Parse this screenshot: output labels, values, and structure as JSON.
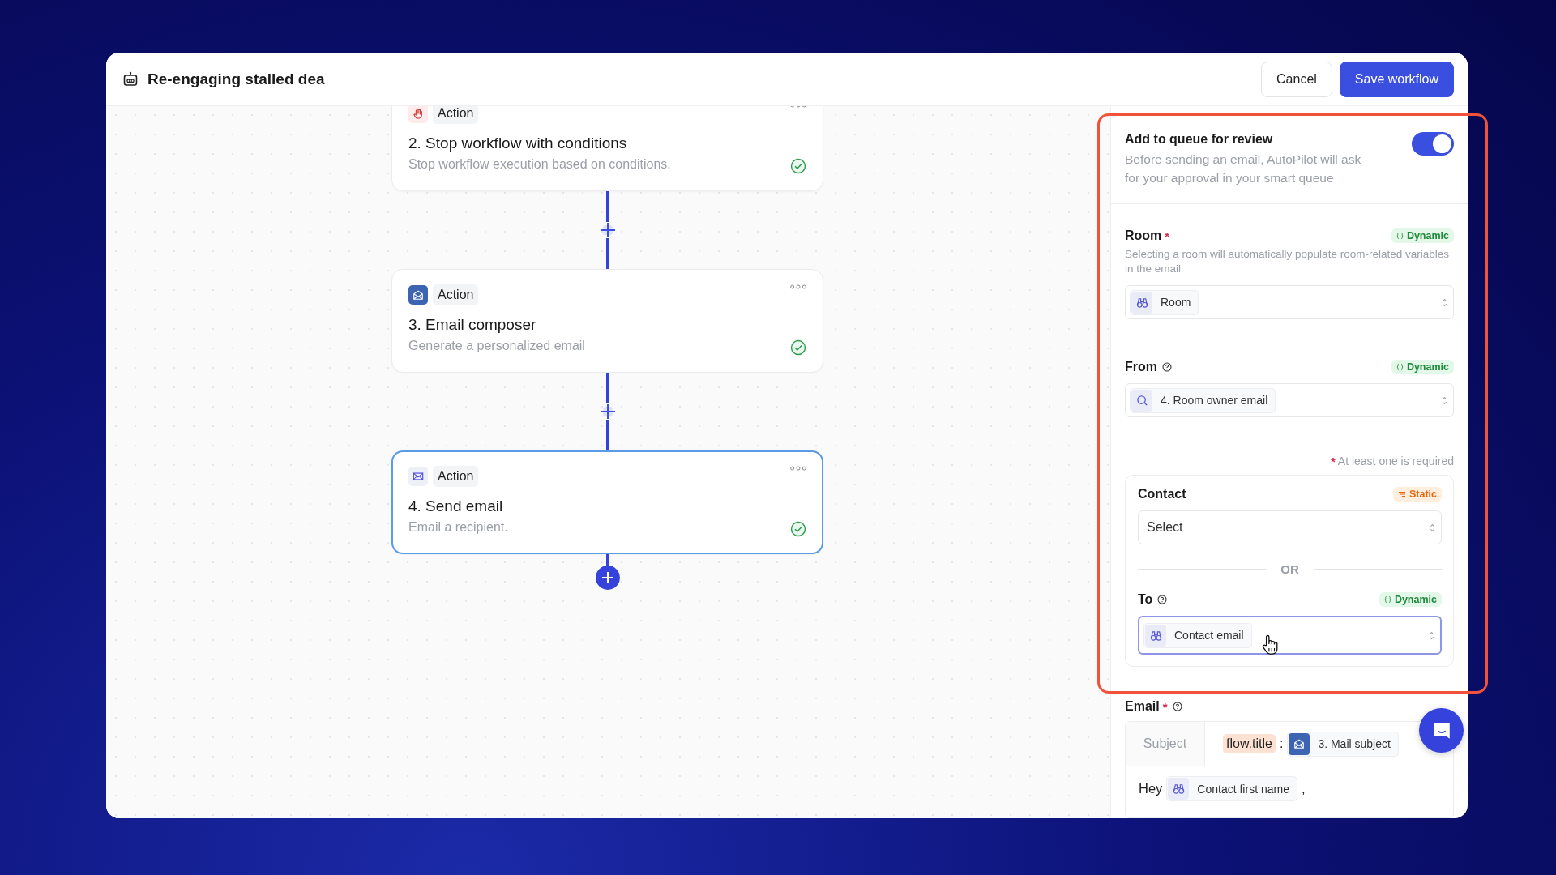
{
  "header": {
    "title": "Re-engaging stalled dea",
    "buttons": [
      {
        "label": "Cancel",
        "kind": "secondary"
      },
      {
        "label": "Save workflow",
        "kind": "primary"
      }
    ]
  },
  "steps": [
    {
      "tag": "Action",
      "kind": "condition",
      "title": "2. Stop workflow with conditions",
      "description": "Stop workflow execution based on conditions.",
      "selected": false
    },
    {
      "tag": "Action",
      "kind": "composer",
      "title": "3. Email composer",
      "description": "Generate a personalized email",
      "selected": false
    },
    {
      "tag": "Action",
      "kind": "send",
      "title": "4. Send email",
      "description": "Email a recipient.",
      "selected": true
    }
  ],
  "panel": {
    "review": {
      "title": "Add to queue for review",
      "description": "Before sending an email, AutoPilot will ask for your approval in your smart queue",
      "on": true
    },
    "fields": [
      {
        "label": "Room",
        "required_mark": "*",
        "help_icon": false,
        "badge": {
          "label": "Dynamic",
          "kind": "dynamic"
        },
        "hint": "Selecting a room will automatically populate room-related variables in the email",
        "value": {
          "label": "Room"
        }
      },
      {
        "label": "From",
        "help_icon": true,
        "badge": {
          "label": "Dynamic",
          "kind": "dynamic"
        },
        "value": {
          "label": "4. Room owner email"
        }
      }
    ],
    "requirement_note": {
      "mark": "*",
      "text": "At least one is required"
    },
    "contact": {
      "label": "Contact",
      "badge": {
        "label": "Static",
        "kind": "static"
      },
      "placeholder": "Select"
    },
    "separator": "OR",
    "to": {
      "label": "To",
      "help_icon": true,
      "badge": {
        "label": "Dynamic",
        "kind": "dynamic"
      },
      "value": {
        "label": "Contact email"
      },
      "focused": true
    },
    "email": {
      "label": "Email",
      "required_mark": "*",
      "help_icon": true,
      "subject_label": "Subject",
      "subject_parts": [
        {
          "kind": "variable",
          "text": "flow.title"
        },
        {
          "kind": "text",
          "text": ":"
        },
        {
          "kind": "chip",
          "text": "3. Mail subject"
        }
      ],
      "body_parts": [
        {
          "kind": "text",
          "text": "Hey"
        },
        {
          "kind": "chip",
          "text": "Contact first name"
        },
        {
          "kind": "text",
          "text": ","
        }
      ]
    }
  }
}
